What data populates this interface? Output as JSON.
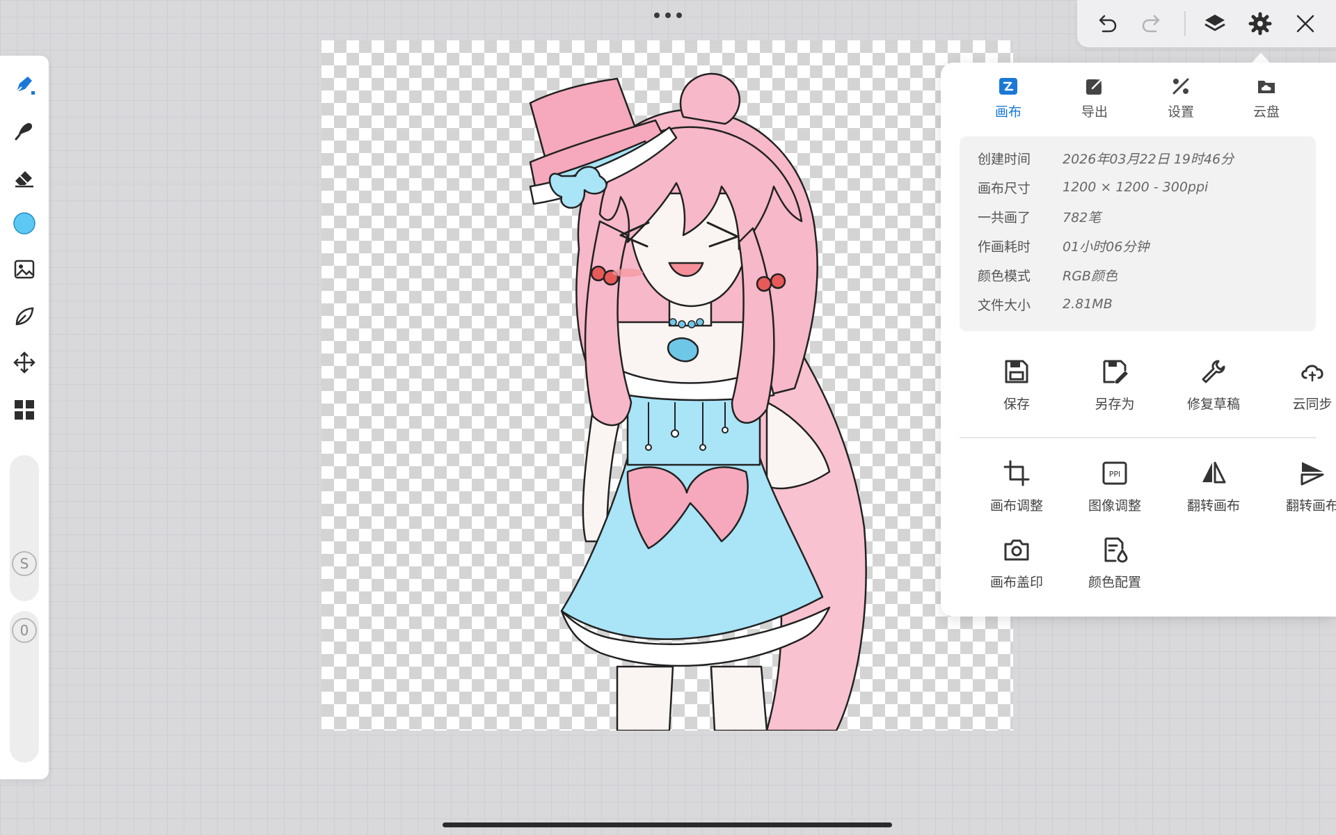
{
  "top_bar": {
    "buttons": [
      {
        "name": "undo",
        "icon": "undo-icon"
      },
      {
        "name": "redo",
        "icon": "redo-icon"
      },
      {
        "name": "layers",
        "icon": "layers-icon"
      },
      {
        "name": "settings",
        "icon": "gear-icon"
      },
      {
        "name": "close",
        "icon": "close-icon"
      }
    ]
  },
  "left_toolbar": {
    "tools": [
      {
        "name": "pen",
        "icon": "pen-icon",
        "active": true
      },
      {
        "name": "brush",
        "icon": "brush-icon"
      },
      {
        "name": "eraser",
        "icon": "eraser-icon"
      },
      {
        "name": "color",
        "icon": "color-swatch",
        "color": "#5ec8f5"
      },
      {
        "name": "image",
        "icon": "image-icon"
      },
      {
        "name": "leaf",
        "icon": "leaf-icon"
      },
      {
        "name": "move",
        "icon": "move-icon"
      },
      {
        "name": "grid",
        "icon": "grid-icon"
      }
    ],
    "size_label": "S",
    "opacity_label": "0"
  },
  "panel": {
    "tabs": [
      {
        "label": "画布",
        "icon": "canvas-icon",
        "active": true
      },
      {
        "label": "导出",
        "icon": "export-icon"
      },
      {
        "label": "设置",
        "icon": "settings-tools-icon"
      },
      {
        "label": "云盘",
        "icon": "cloud-drive-icon"
      }
    ],
    "info": [
      {
        "key": "创建时间",
        "value": "2026年03月22日 19时46分"
      },
      {
        "key": "画布尺寸",
        "value": "1200 × 1200 - 300ppi"
      },
      {
        "key": "一共画了",
        "value": "782笔"
      },
      {
        "key": "作画耗时",
        "value": "01小时06分钟"
      },
      {
        "key": "颜色模式",
        "value": "RGB颜色"
      },
      {
        "key": "文件大小",
        "value": "2.81MB"
      }
    ],
    "actions_row1": [
      {
        "label": "保存",
        "icon": "save-icon"
      },
      {
        "label": "另存为",
        "icon": "save-as-icon"
      },
      {
        "label": "修复草稿",
        "icon": "wrench-icon"
      },
      {
        "label": "云同步",
        "icon": "cloud-sync-icon"
      }
    ],
    "actions_row2": [
      {
        "label": "画布调整",
        "icon": "crop-icon"
      },
      {
        "label": "图像调整",
        "icon": "ppi-icon",
        "badge": "PPI"
      },
      {
        "label": "翻转画布",
        "icon": "flip-horizontal-icon"
      },
      {
        "label": "翻转画布",
        "icon": "flip-vertical-icon"
      }
    ],
    "actions_row3": [
      {
        "label": "画布盖印",
        "icon": "camera-icon"
      },
      {
        "label": "颜色配置",
        "icon": "color-profile-icon"
      }
    ]
  },
  "colors": {
    "accent": "#1a78d6",
    "hair": "#f7b8c9",
    "dress": "#a9e4f7",
    "bow": "#f6a9bc"
  }
}
